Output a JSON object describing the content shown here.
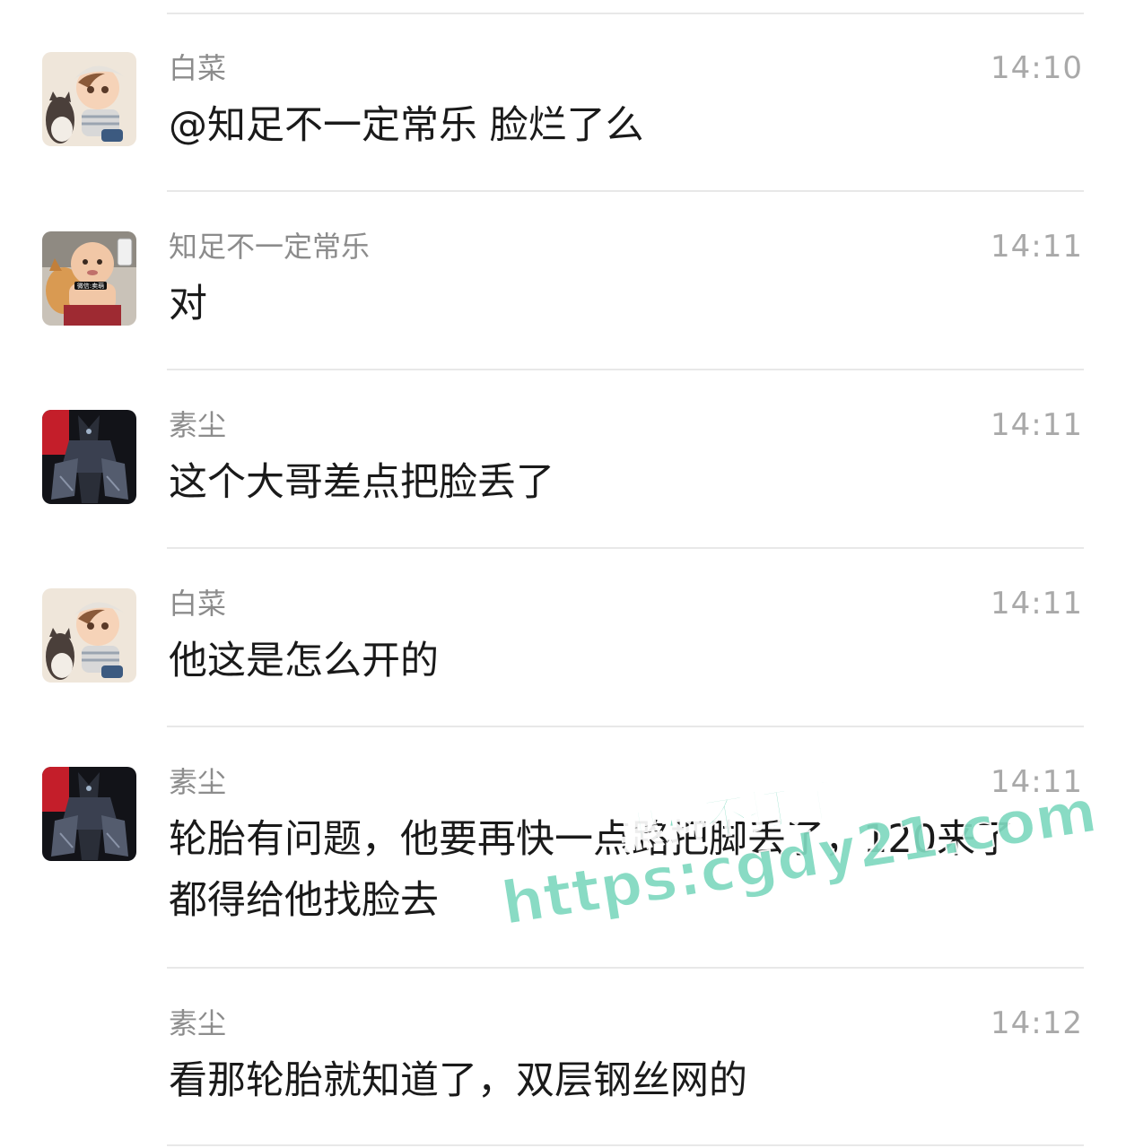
{
  "messages": [
    {
      "sender": "白菜",
      "time": "14:10",
      "text": "@知足不一定常乐 脸烂了么",
      "avatar": "boy-with-cat-avatar"
    },
    {
      "sender": "知足不一定常乐",
      "time": "14:11",
      "text": "对",
      "avatar": "baby-selfie-avatar"
    },
    {
      "sender": "素尘",
      "time": "14:11",
      "text": "这个大哥差点把脸丢了",
      "avatar": "dark-armor-avatar"
    },
    {
      "sender": "白菜",
      "time": "14:11",
      "text": "他这是怎么开的",
      "avatar": "boy-with-cat-avatar"
    },
    {
      "sender": "素尘",
      "time": "14:11",
      "text_line1": "轮胎有问题，他要再快一点路把脚丢了，120来了",
      "text_line2": "都得给他找脸去",
      "avatar": "dark-armor-avatar"
    },
    {
      "sender": "素尘",
      "time": "14:12",
      "text": "看那轮胎就知道了，双层钢丝网的"
    }
  ],
  "watermark": {
    "line1": "黑料不打烊",
    "line2": "https:cgdy21.com",
    "color": "#7fd9bf"
  },
  "avatar_badge": "微信:卖萌"
}
